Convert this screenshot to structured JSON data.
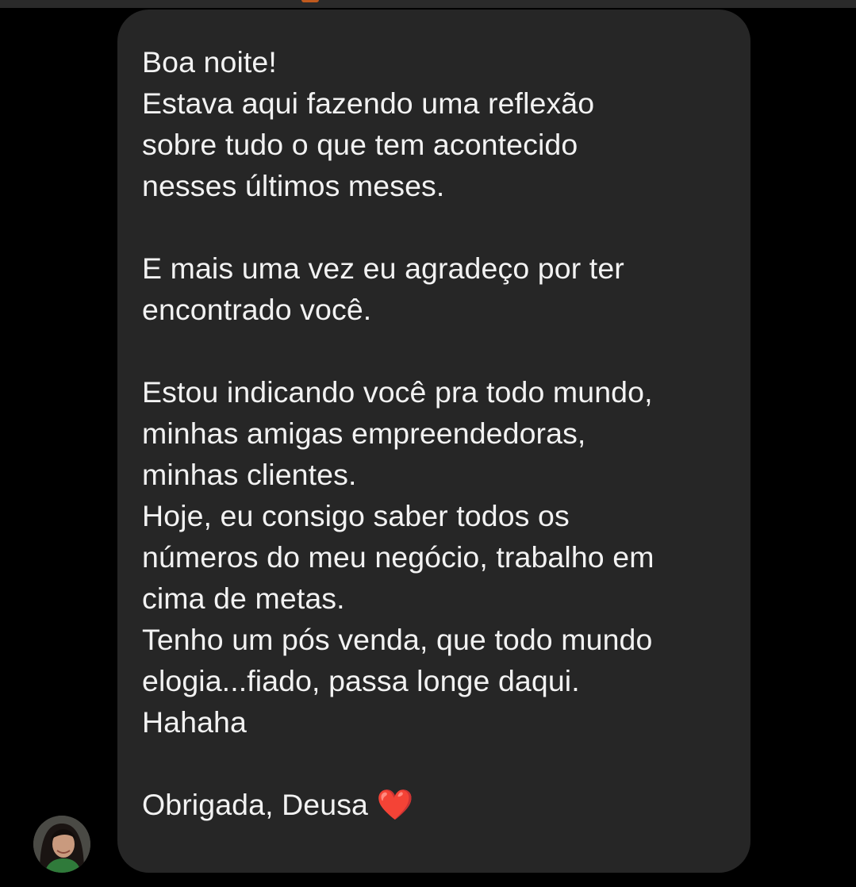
{
  "conversation": {
    "message": {
      "text": "Boa noite!\nEstava aqui fazendo uma reflexão\nsobre tudo o que tem acontecido\nnesses últimos meses.\n\nE mais uma vez eu agradeço por ter\nencontrado você.\n\nEstou indicando você pra todo mundo,\nminhas amigas empreendedoras,\nminhas clientes.\nHoje, eu consigo saber todos os\nnúmeros do meu negócio, trabalho em\ncima de metas.\nTenho um pós venda, que todo mundo\nelogia...fiado, passa longe daqui.\nHahaha\n\nObrigada, Deusa ❤️",
      "reaction_icon": "red-heart-emoji"
    },
    "sender_avatar": {
      "icon": "user-avatar"
    }
  },
  "colors": {
    "background": "#000000",
    "bubble": "#262626",
    "text": "#f2f2f2",
    "heart": "#e0245e"
  }
}
